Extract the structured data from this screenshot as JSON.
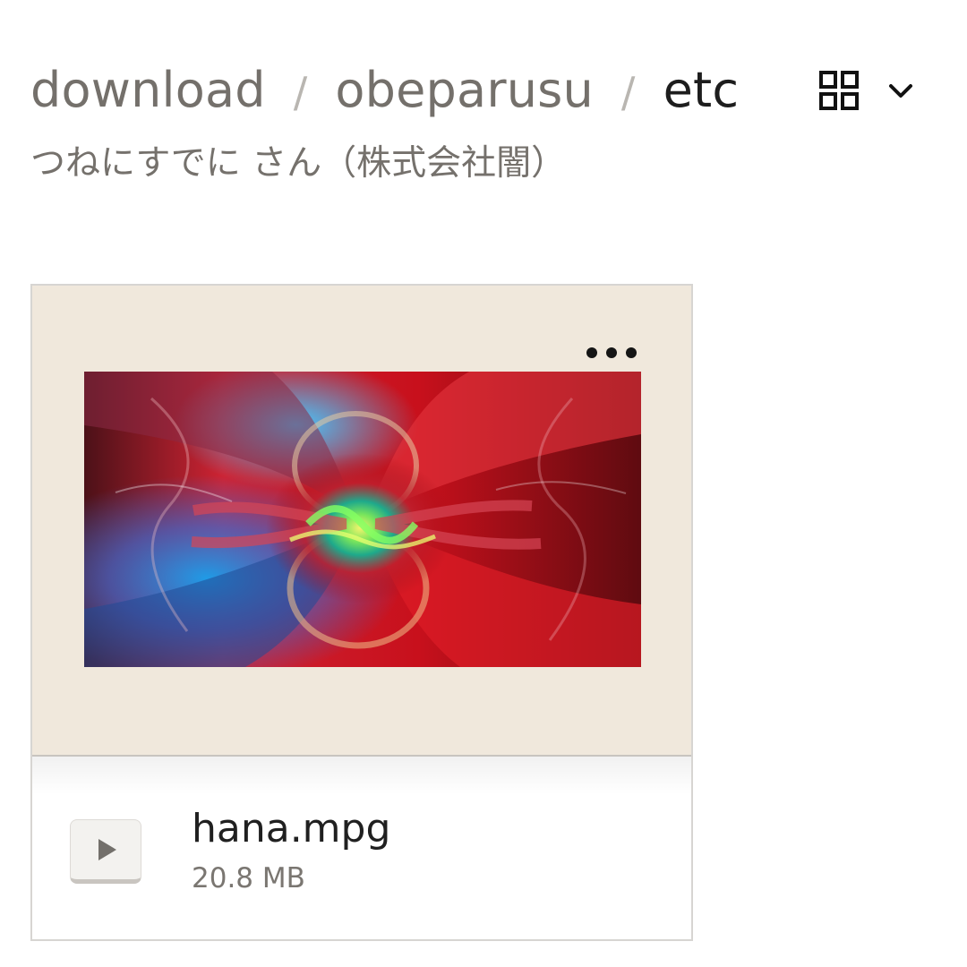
{
  "breadcrumb": {
    "items": [
      "download",
      "obeparusu",
      "etc"
    ],
    "separator": "/"
  },
  "owner": {
    "label": "つねにすでに さん（株式会社闇）"
  },
  "view_toggle": {
    "icon": "grid-view-icon",
    "menu_icon": "chevron-down-icon"
  },
  "file": {
    "name": "hana.mpg",
    "size": "20.8 MB",
    "type_icon": "play-icon",
    "more_icon": "more-horizontal-icon",
    "preview_bg": "#f0e8dc"
  },
  "colors": {
    "crumb": "#74706b",
    "crumb_current": "#1d1d1d",
    "separator": "#b9b6b1",
    "owner": "#75716c",
    "preview_bg": "#f0e8dc"
  }
}
